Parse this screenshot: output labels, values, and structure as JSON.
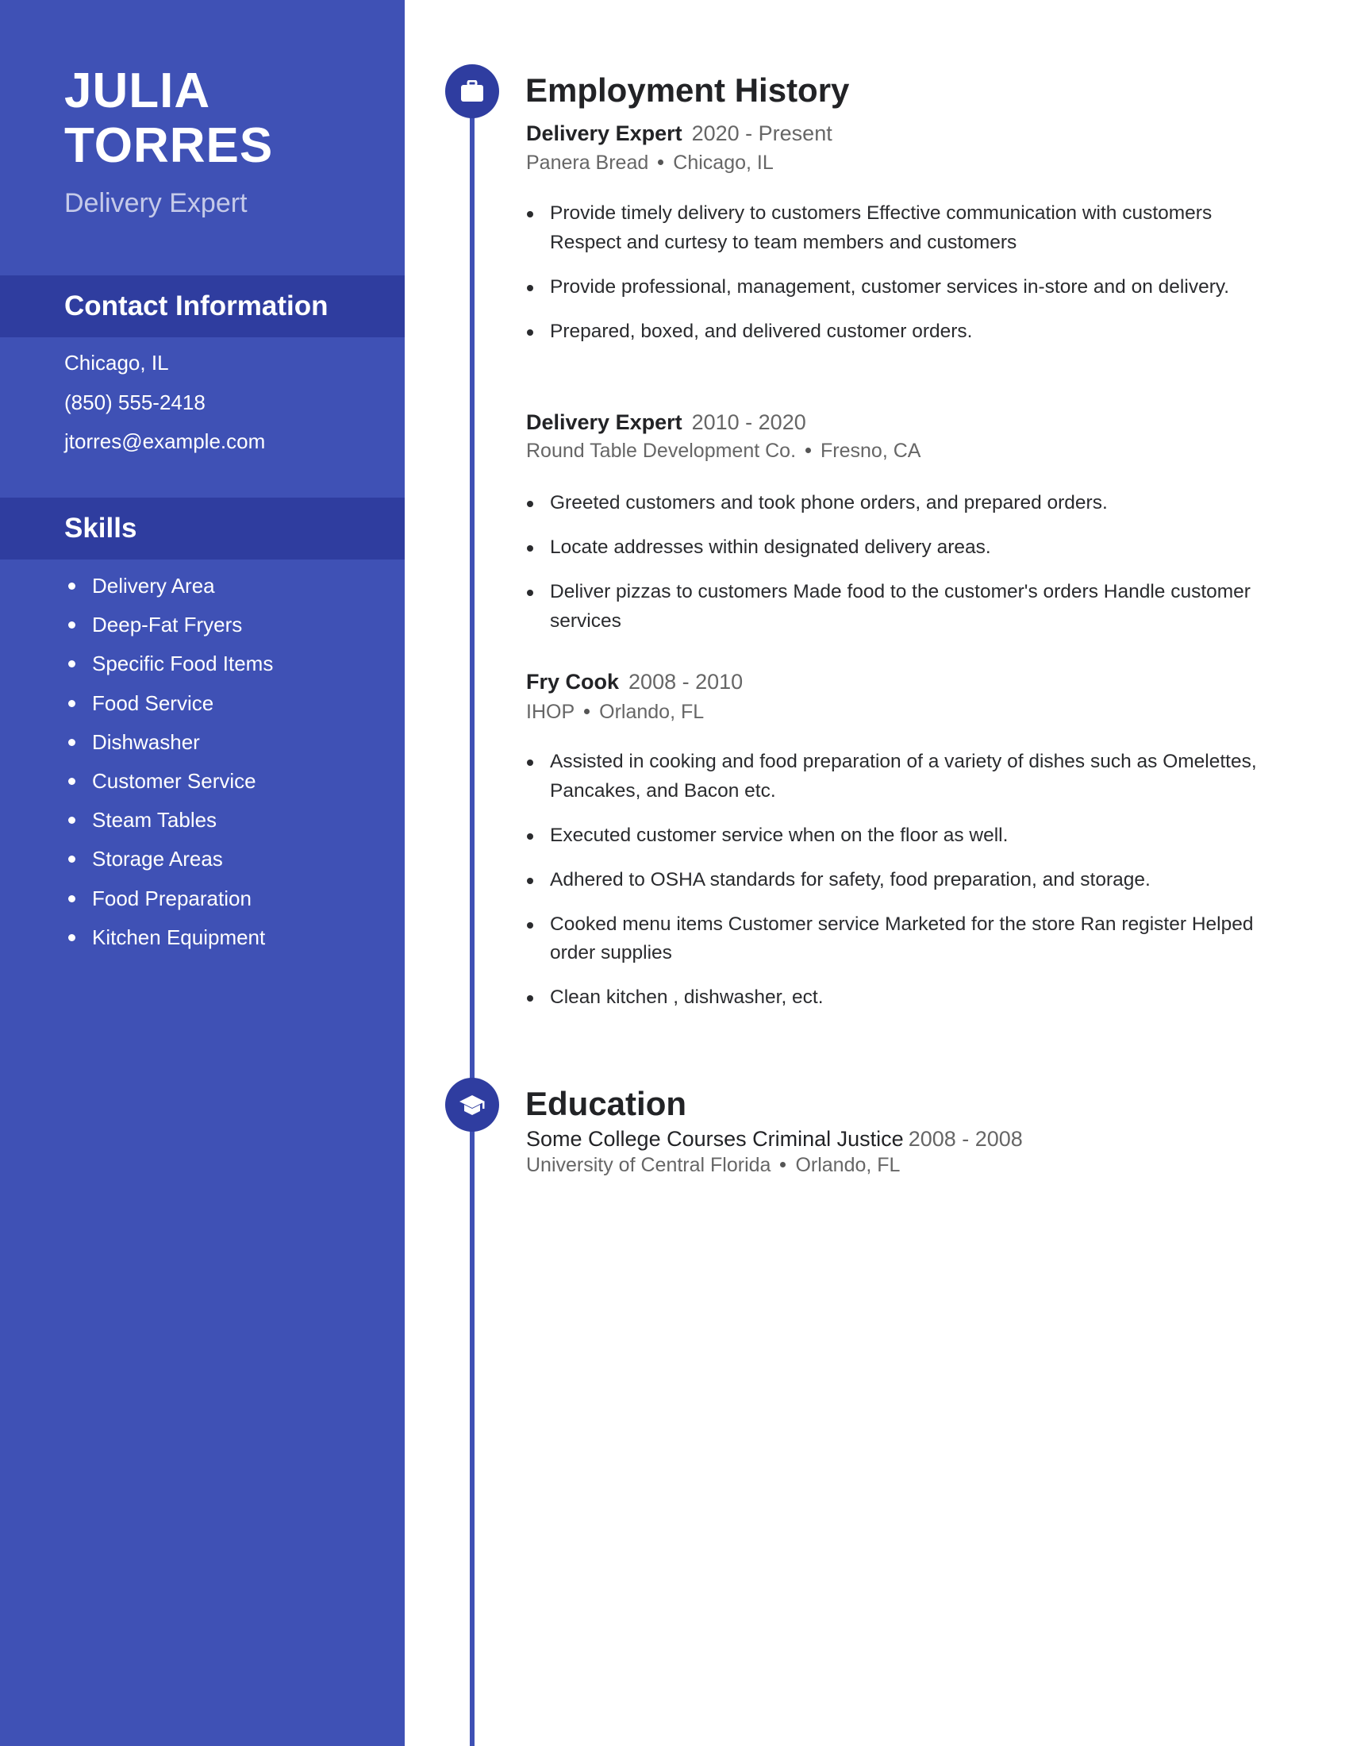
{
  "sidebar": {
    "name_first": "JULIA",
    "name_last": "TORRES",
    "headline": "Delivery Expert",
    "contact_heading": "Contact Information",
    "contact": {
      "location": "Chicago, IL",
      "phone": "(850) 555-2418",
      "email": "jtorres@example.com"
    },
    "skills_heading": "Skills",
    "skills": [
      "Delivery Area",
      "Deep-Fat Fryers",
      "Specific Food Items",
      "Food Service",
      "Dishwasher",
      "Customer Service",
      "Steam Tables",
      "Storage Areas",
      "Food Preparation",
      "Kitchen Equipment"
    ]
  },
  "employment": {
    "heading": "Employment History",
    "icon": "briefcase-icon",
    "jobs": [
      {
        "role": "Delivery Expert",
        "dates": "2020 - Present",
        "company": "Panera Bread",
        "location": "Chicago, IL",
        "bullets": [
          "Provide timely delivery to customers Effective communication with customers Respect and curtesy to team members and customers",
          "Provide professional, management, customer services in-store and on delivery.",
          "Prepared, boxed, and delivered customer orders."
        ]
      },
      {
        "role": "Delivery Expert",
        "dates": "2010 - 2020",
        "company": "Round Table Development Co.",
        "location": "Fresno, CA",
        "bullets": [
          "Greeted customers and took phone orders, and prepared orders.",
          "Locate addresses within designated delivery areas.",
          "Deliver pizzas to customers Made food to the customer's orders Handle customer services"
        ]
      },
      {
        "role": "Fry Cook",
        "dates": "2008 - 2010",
        "company": "IHOP",
        "location": "Orlando, FL",
        "bullets": [
          "Assisted in cooking and food preparation of a variety of dishes such as Omelettes, Pancakes, and Bacon etc.",
          "Executed customer service when on the floor as well.",
          "Adhered to OSHA standards for safety, food preparation, and storage.",
          "Cooked menu items Customer service Marketed for the store Ran register Helped order supplies",
          "Clean kitchen , dishwasher, ect."
        ]
      }
    ]
  },
  "education": {
    "heading": "Education",
    "icon": "graduation-cap-icon",
    "entries": [
      {
        "degree": "Some College Courses Criminal Justice",
        "dates": "2008 - 2008",
        "school": "University of Central Florida",
        "location": "Orlando, FL"
      }
    ]
  },
  "colors": {
    "sidebar": "#3f51b5",
    "sidebar_band": "#2f3d9f",
    "accent_circle": "#2f3da0",
    "text_dark": "#222326",
    "text_muted": "#666666"
  }
}
